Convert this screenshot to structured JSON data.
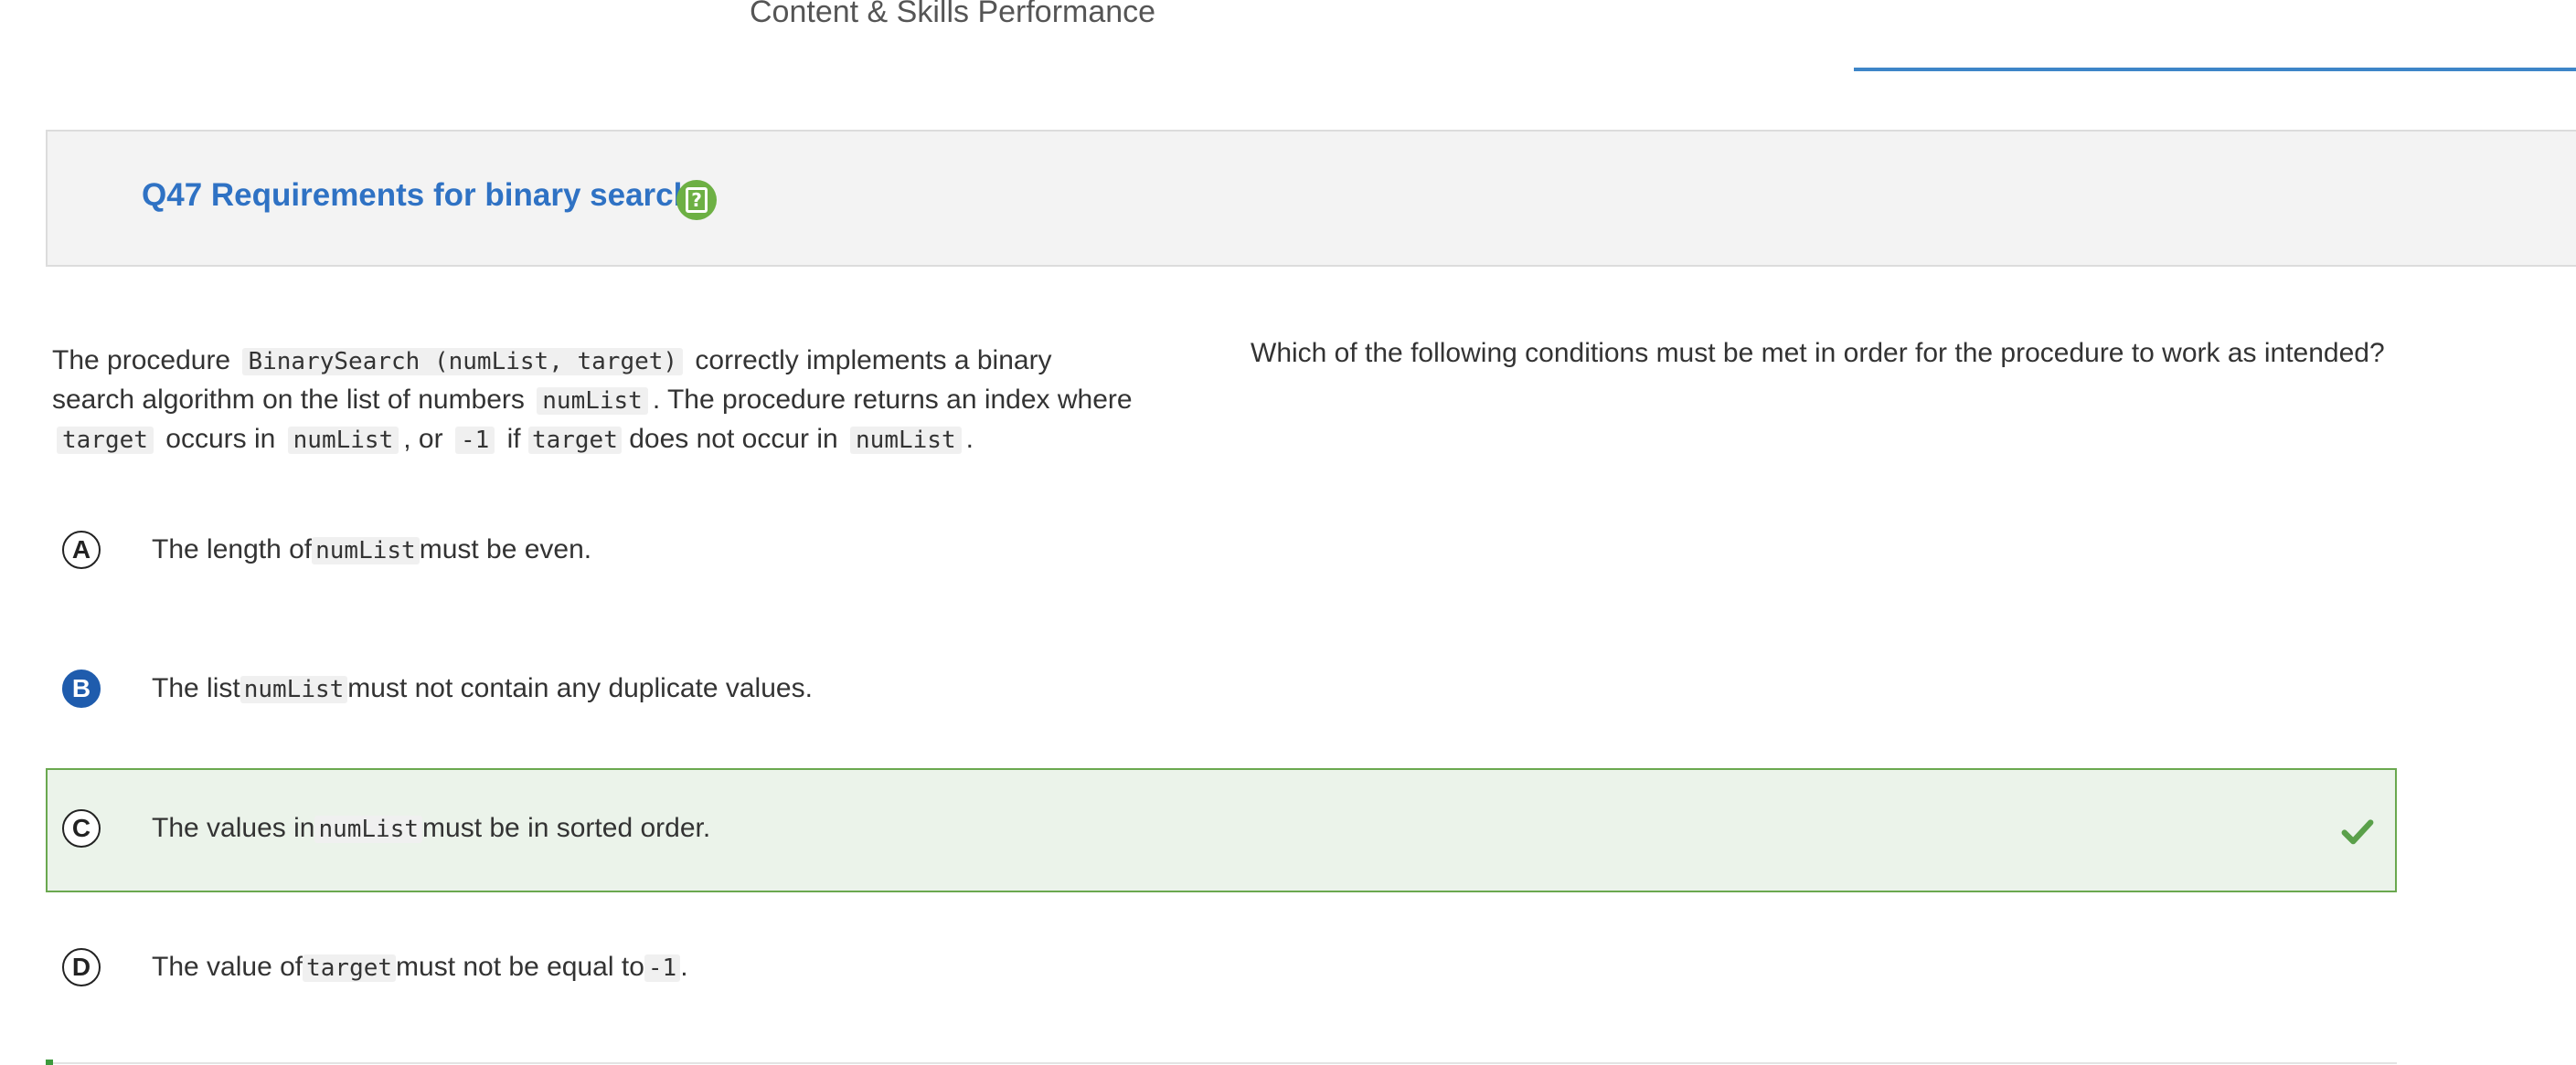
{
  "header": {
    "title": "Content & Skills Performance"
  },
  "question": {
    "title": "Q47 Requirements for binary search",
    "help_glyph": "?"
  },
  "stimulus": {
    "t1": "The procedure",
    "c1": "BinarySearch (numList, target)",
    "t2": "correctly implements a binary search algorithm on the list of numbers",
    "c2": "numList",
    "t3": ". The procedure returns an index where",
    "c3": "target",
    "t4": "occurs in",
    "c4": "numList",
    "t5": ", or",
    "c5": "-1",
    "t6": "if",
    "c6": "target",
    "t7": "does not occur in",
    "c7": "numList",
    "t8": "."
  },
  "stem": "Which of the following conditions must be met in order for the procedure to work as intended?",
  "options": [
    {
      "letter": "A",
      "pre": "The length of",
      "code": "numList",
      "post": "must be even.",
      "selected": false,
      "correct": false
    },
    {
      "letter": "B",
      "pre": "The list",
      "code": "numList",
      "post": "must not contain any duplicate values.",
      "selected": true,
      "correct": false
    },
    {
      "letter": "C",
      "pre": "The values in",
      "code": "numList",
      "post": "must be in sorted order.",
      "selected": false,
      "correct": true
    },
    {
      "letter": "D",
      "pre": "The value of",
      "code": "target",
      "post": "must not be equal to",
      "code2": "-1",
      "post2": ".",
      "selected": false,
      "correct": false
    }
  ],
  "icons": {
    "help": "help-icon",
    "correct": "checkmark-icon"
  },
  "colors": {
    "accent_blue": "#2f72c4",
    "selected_blue": "#1f5cad",
    "correct_green": "#6aa84f",
    "help_green": "#6db044"
  }
}
